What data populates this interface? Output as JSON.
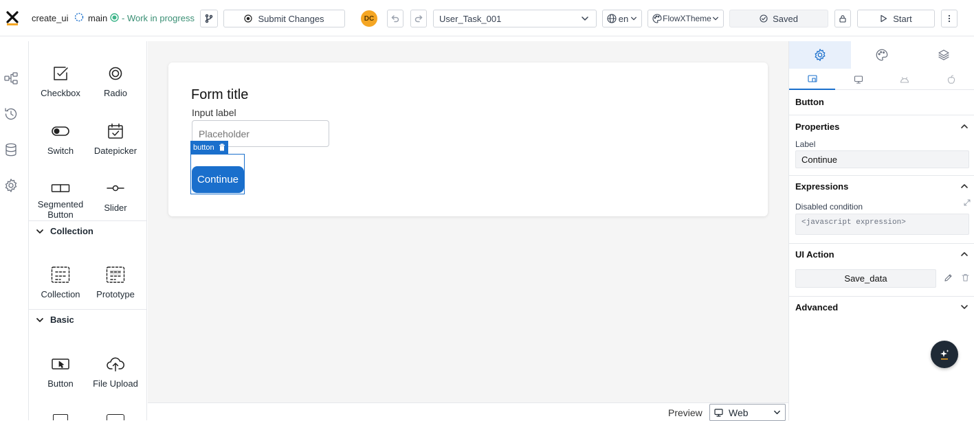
{
  "topbar": {
    "app_name": "create_ui",
    "branch": "main",
    "branch_status": "- Work in progress",
    "submit_label": "Submit Changes",
    "avatar_initials": "DC",
    "task_select": "User_Task_001",
    "language": "en",
    "theme": "FlowXTheme",
    "saved_label": "Saved",
    "start_label": "Start"
  },
  "palette": {
    "items_top": [
      {
        "label": "Checkbox",
        "icon": "checkbox-icon"
      },
      {
        "label": "Radio",
        "icon": "radio-icon"
      },
      {
        "label": "Switch",
        "icon": "switch-icon"
      },
      {
        "label": "Datepicker",
        "icon": "datepicker-icon"
      },
      {
        "label": "Segmented Button",
        "icon": "segmented-button-icon"
      },
      {
        "label": "Slider",
        "icon": "slider-icon"
      }
    ],
    "collection_title": "Collection",
    "collection_items": [
      {
        "label": "Collection",
        "icon": "collection-icon"
      },
      {
        "label": "Prototype",
        "icon": "prototype-icon"
      }
    ],
    "basic_title": "Basic",
    "basic_items": [
      {
        "label": "Button",
        "icon": "button-icon"
      },
      {
        "label": "File Upload",
        "icon": "file-upload-icon"
      }
    ]
  },
  "canvas": {
    "form_title": "Form title",
    "input_label": "Input label",
    "input_placeholder": "Placeholder",
    "selection_tag": "button",
    "button_label": "Continue",
    "preview_label": "Preview",
    "preview_mode": "Web"
  },
  "panel": {
    "component_name": "Button",
    "properties_title": "Properties",
    "label_caption": "Label",
    "label_value": "Continue",
    "expressions_title": "Expressions",
    "disabled_caption": "Disabled condition",
    "disabled_placeholder": "<javascript expression>",
    "ui_action_title": "UI Action",
    "ui_action_value": "Save_data",
    "advanced_title": "Advanced"
  },
  "colors": {
    "primary": "#1a6fcc",
    "accent": "#f5a623",
    "active_tab_bg": "#e8f0fb",
    "status_green": "#3fb68b"
  }
}
